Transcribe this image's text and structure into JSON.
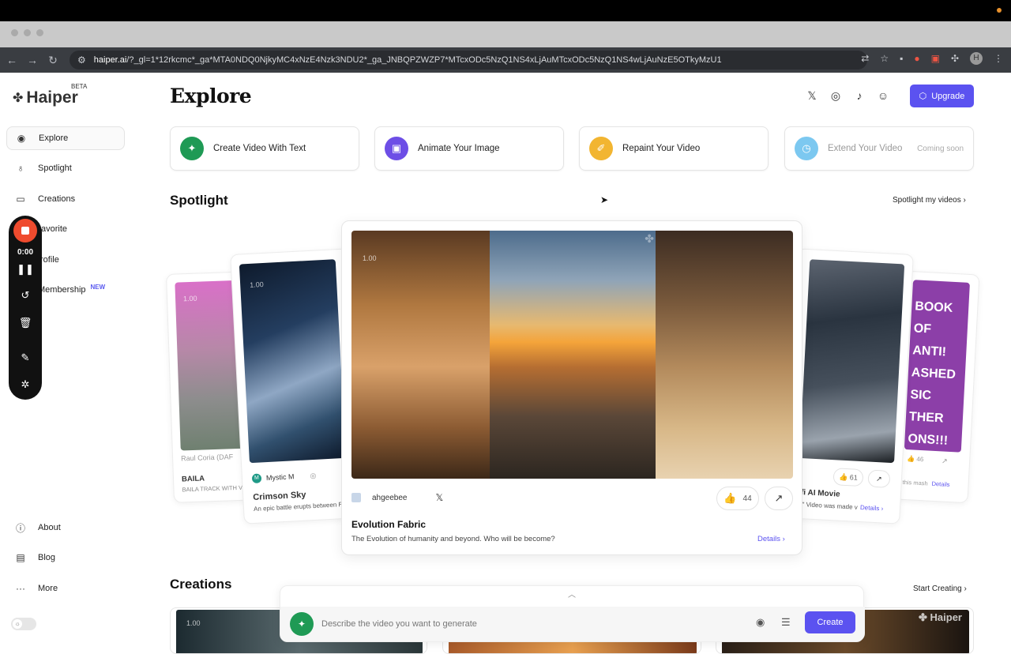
{
  "browser": {
    "url_host": "haiper.ai",
    "url_rest": "/?_gl=1*12rkcmc*_ga*MTA0NDQ0NjkyMC4xNzE4Nzk3NDU2*_ga_JNBQPZWZP7*MTcxODc5NzQ1NS4xLjAuMTcxODc5NzQ1NS4wLjAuNzE5OTkyMzU1",
    "profile_initial": "H"
  },
  "brand": {
    "name": "Haiper",
    "badge": "BETA"
  },
  "sidebar": {
    "items": [
      {
        "label": "Explore",
        "icon": "compass-icon"
      },
      {
        "label": "Spotlight",
        "icon": "bulb-icon"
      },
      {
        "label": "Creations",
        "icon": "video-icon"
      },
      {
        "label": "Favorite",
        "icon": "heart-icon"
      },
      {
        "label": "Profile",
        "icon": "user-icon"
      },
      {
        "label": "Membership",
        "icon": "crown-icon",
        "badge": "NEW"
      }
    ],
    "footer": [
      {
        "label": "About",
        "icon": "info-icon"
      },
      {
        "label": "Blog",
        "icon": "blog-icon"
      },
      {
        "label": "More",
        "icon": "more-icon"
      }
    ],
    "visible_favorite": "avorite",
    "visible_profile": "rofile",
    "visible_membership": "Membership"
  },
  "recorder": {
    "time": "0:00"
  },
  "header": {
    "title": "Explore",
    "upgrade": "Upgrade"
  },
  "actions": [
    {
      "label": "Create Video With Text",
      "color": "#1f9a55"
    },
    {
      "label": "Animate Your Image",
      "color": "#6d4ee6"
    },
    {
      "label": "Repaint Your Video",
      "color": "#f2b531"
    },
    {
      "label": "Extend Your Video",
      "color": "#7cc8f0",
      "badge": "Coming soon"
    }
  ],
  "spotlight": {
    "title": "Spotlight",
    "link": "Spotlight my videos",
    "overlay_tag": "1.00",
    "main": {
      "author": "ahgeebee",
      "likes": "44",
      "title": "Evolution Fabric",
      "desc": "The Evolution of humanity and beyond. Who will be become?",
      "details": "Details"
    },
    "left1": {
      "author": "Raul Coria (DAF",
      "title": "BAILA",
      "desc": "BAILA TRACK WITH V"
    },
    "left2": {
      "author": "Mystic M",
      "title": "Crimson Sky",
      "desc": "An epic battle erupts between Fut",
      "avatar_letter": "M"
    },
    "right1": {
      "likes": "61",
      "title": "i-fi AI Movie",
      "desc": "us\" Video was made v",
      "details": "Details"
    },
    "right2": {
      "likes": "46",
      "desc": "this mash",
      "details": "Details",
      "poster_text": "BOOK OF ANTI! ASHED SIC THER ONS!!!"
    }
  },
  "creations": {
    "title": "Creations",
    "link": "Start Creating",
    "watermark": "Haiper",
    "overlay_tag": "1.00"
  },
  "prompt": {
    "placeholder": "Describe the video you want to generate",
    "create": "Create"
  }
}
